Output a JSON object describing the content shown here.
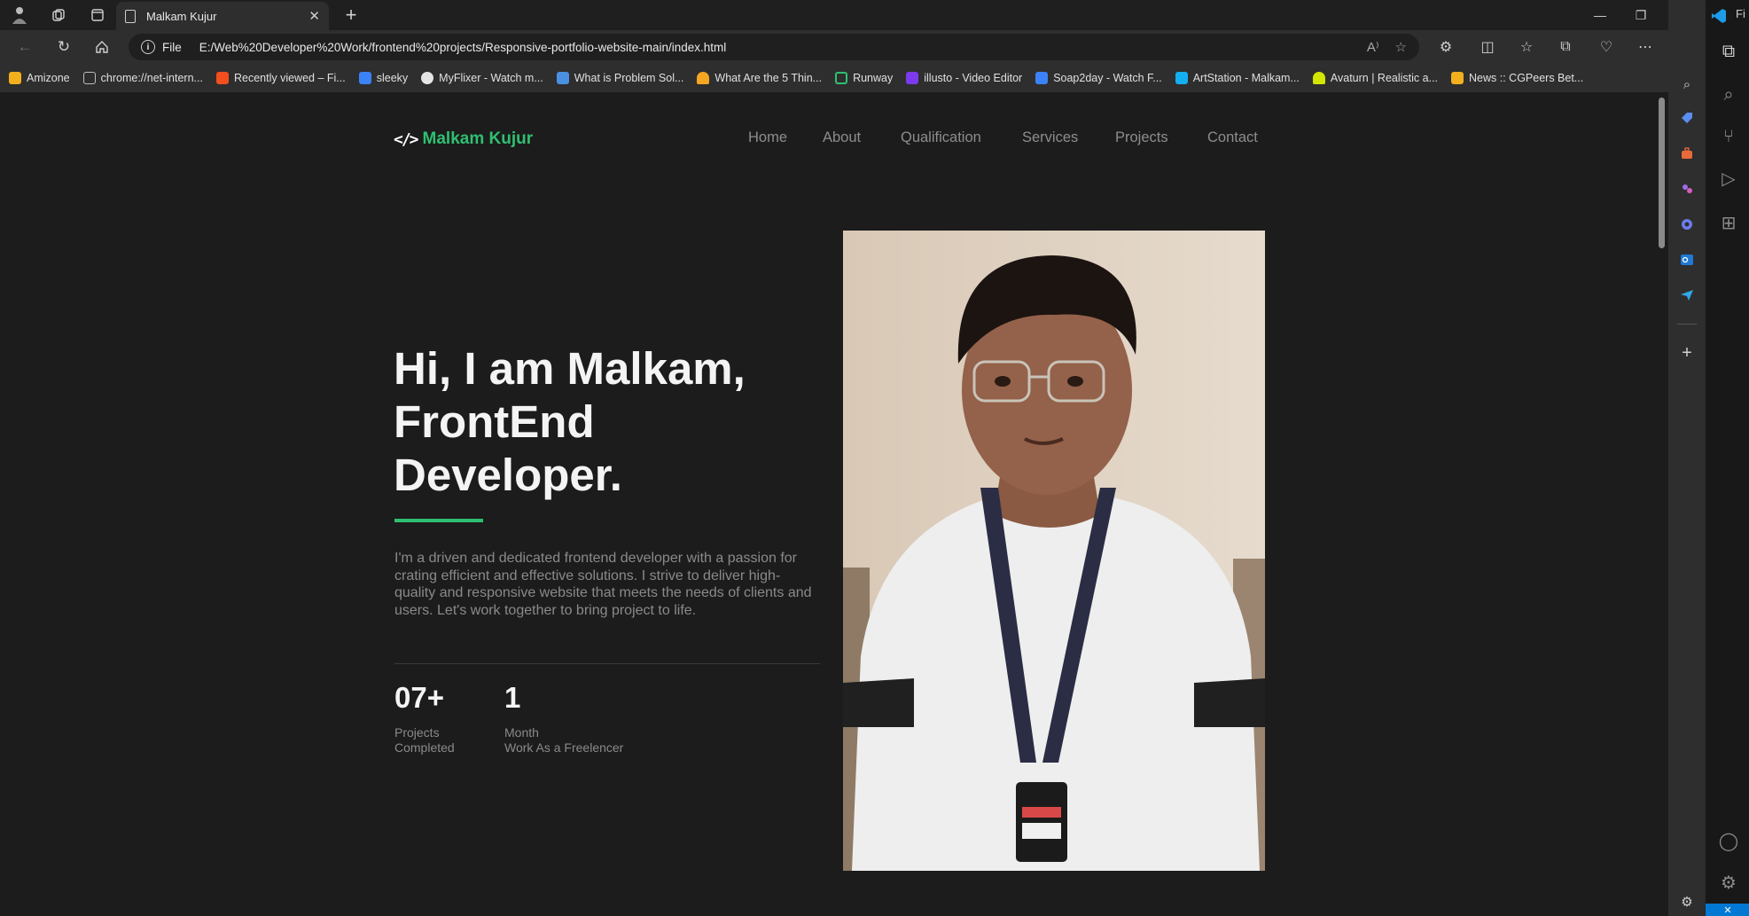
{
  "browser": {
    "tab_title": "Malkam Kujur",
    "address": {
      "scheme": "File",
      "url": "E:/Web%20Developer%20Work/frontend%20projects/Responsive-portfolio-website-main/index.html"
    },
    "bookmarks": [
      {
        "label": "Amizone",
        "color": "#f2b01e"
      },
      {
        "label": "chrome://net-intern...",
        "color": "#bdbdbd"
      },
      {
        "label": "Recently viewed – Fi...",
        "color": "#f24e1e"
      },
      {
        "label": "sleeky",
        "color": "#3b82f6"
      },
      {
        "label": "MyFlixer - Watch m...",
        "color": "#e5e5e5"
      },
      {
        "label": "What is Problem Sol...",
        "color": "#4a90e2"
      },
      {
        "label": "What Are the 5 Thin...",
        "color": "#f5a623"
      },
      {
        "label": "Runway",
        "color": "#2fbf71"
      },
      {
        "label": "illusto - Video Editor",
        "color": "#7c3aed"
      },
      {
        "label": "Soap2day - Watch F...",
        "color": "#3b82f6"
      },
      {
        "label": "ArtStation - Malkam...",
        "color": "#13aff0"
      },
      {
        "label": "Avaturn | Realistic a...",
        "color": "#d4e600"
      },
      {
        "label": "News :: CGPeers Bet...",
        "color": "#f2b01e"
      }
    ],
    "vscode_title_fragment": "Fi"
  },
  "site": {
    "logo": {
      "icon": "</>",
      "name": "Malkam Kujur"
    },
    "nav": [
      "Home",
      "About",
      "Qualification",
      "Services",
      "Projects",
      "Contact"
    ],
    "hero": {
      "title_lines": [
        "Hi, I am Malkam,",
        "FrontEnd",
        "Developer."
      ],
      "description": "I'm a driven and dedicated frontend developer with a passion for crating efficient and effective solutions. I strive to deliver high-quality and responsive website that meets the needs of clients and users. Let's work together to bring project to life."
    },
    "stats": [
      {
        "number": "07+",
        "label_1": "Projects",
        "label_2": "Completed"
      },
      {
        "number": "1",
        "label_1": "Month",
        "label_2": "Work As a Freelencer"
      }
    ],
    "colors": {
      "accent": "#2fbf71",
      "background": "#1c1c1c"
    }
  }
}
